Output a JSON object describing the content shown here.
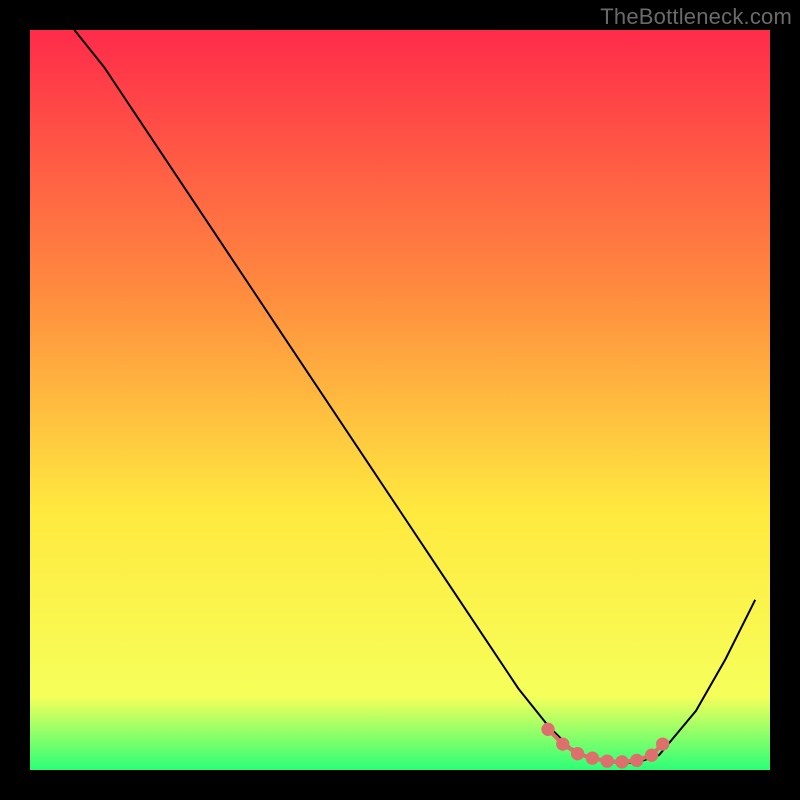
{
  "watermark": "TheBottleneck.com",
  "colors": {
    "background": "#000000",
    "curve": "#000000",
    "marker_fill": "#dd6f6d",
    "marker_stroke": "#dd6f6d",
    "gradient_top": "#ff2b4a",
    "gradient_mid1": "#ff8a3f",
    "gradient_mid2": "#ffe93f",
    "gradient_yellowgreen": "#f6ff5a",
    "gradient_green": "#2cff77"
  },
  "chart_data": {
    "type": "line",
    "title": "",
    "xlabel": "",
    "ylabel": "",
    "xlim": [
      0,
      100
    ],
    "ylim": [
      0,
      100
    ],
    "series": [
      {
        "name": "bottleneck-curve",
        "x": [
          6,
          10,
          14,
          18,
          22,
          26,
          30,
          34,
          38,
          42,
          46,
          50,
          54,
          58,
          62,
          66,
          70,
          73,
          76,
          79,
          82,
          85,
          90,
          94,
          98
        ],
        "y": [
          100,
          95,
          89,
          83,
          77,
          71,
          65,
          59,
          53,
          47,
          41,
          35,
          29,
          23,
          17,
          11,
          6,
          3,
          1.5,
          1,
          1,
          2,
          8,
          15,
          23
        ]
      },
      {
        "name": "marker-band",
        "x": [
          70,
          72,
          74,
          76,
          78,
          80,
          82,
          84,
          85.5
        ],
        "y": [
          5.5,
          3.5,
          2.2,
          1.6,
          1.2,
          1.1,
          1.3,
          2.0,
          3.5
        ]
      }
    ]
  }
}
